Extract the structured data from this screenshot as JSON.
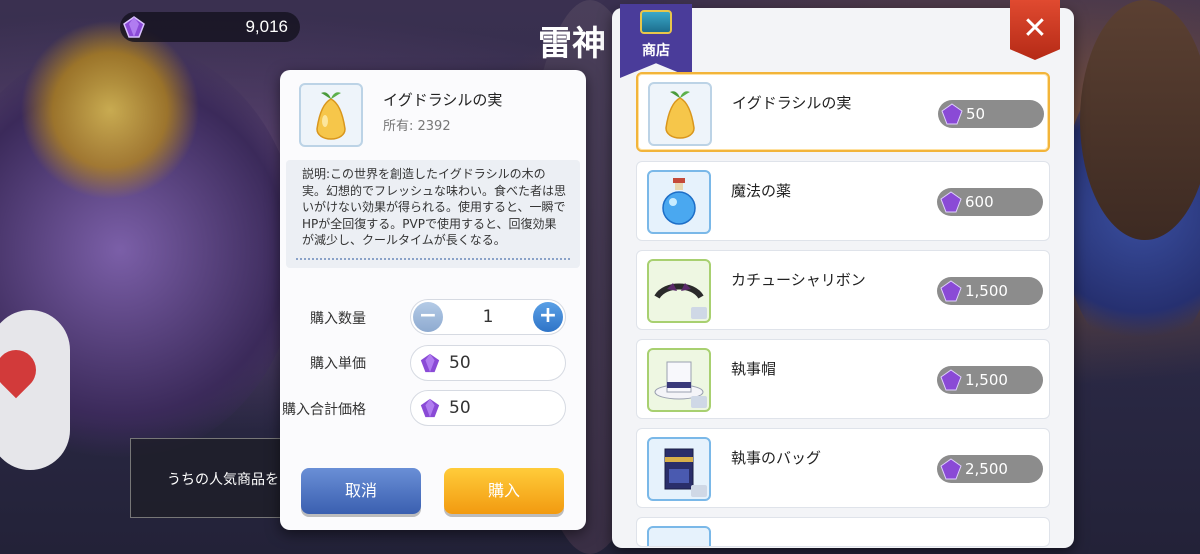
{
  "hud": {
    "currency_amount": "9,016",
    "scene_title": "雷神",
    "popular_banner": "うちの人気商品を"
  },
  "shop": {
    "badge_label": "商店",
    "close_label": "✕"
  },
  "detail": {
    "item_name": "イグドラシルの実",
    "owned_label": "所有: 2392",
    "description": "説明:この世界を創造したイグドラシルの木の実。幻想的でフレッシュな味わい。食べた者は思いがけない効果が得られる。使用すると、一瞬でHPが全回復する。PVPで使用すると、回復効果が減少し、クールタイムが長くなる。",
    "quantity_label": "購入数量",
    "quantity_value": "1",
    "unit_price_label": "購入単価",
    "unit_price": "50",
    "total_price_label": "購入合計価格",
    "total_price": "50",
    "cancel_label": "取消",
    "buy_label": "購入"
  },
  "items": [
    {
      "name": "イグドラシルの実",
      "price": "50",
      "icon": "yggdrasil-fruit-icon"
    },
    {
      "name": "魔法の薬",
      "price": "600",
      "icon": "magic-potion-icon"
    },
    {
      "name": "カチューシャリボン",
      "price": "1,500",
      "icon": "ribbon-headband-icon"
    },
    {
      "name": "執事帽",
      "price": "1,500",
      "icon": "butler-hat-icon"
    },
    {
      "name": "執事のバッグ",
      "price": "2,500",
      "icon": "butler-bag-icon"
    }
  ],
  "colors": {
    "accent_orange": "#f29a10",
    "accent_blue": "#3a5fb0",
    "selected_border": "#f2b43a",
    "gem_purple": "#8a4ad6"
  }
}
